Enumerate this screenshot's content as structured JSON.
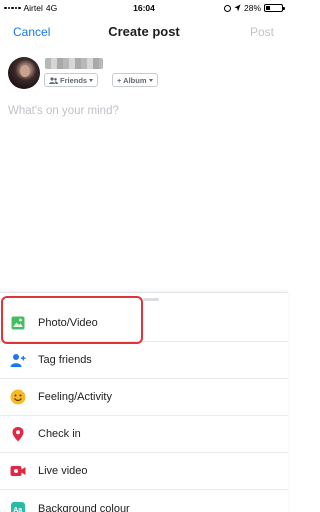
{
  "status_bar": {
    "carrier": "Airtel",
    "network": "4G",
    "time": "16:04",
    "battery_percent": "28%",
    "battery_level": 0.28
  },
  "nav": {
    "cancel_label": "Cancel",
    "title": "Create post",
    "post_label": "Post",
    "accent_color": "#1877f2"
  },
  "composer": {
    "audience_label": "Friends",
    "album_label": "+ Album",
    "placeholder": "What's on your mind?"
  },
  "options": [
    {
      "label": "Photo/Video",
      "icon": "photo-icon",
      "color": "#45bd62"
    },
    {
      "label": "Tag friends",
      "icon": "tag-friends-icon",
      "color": "#1877f2"
    },
    {
      "label": "Feeling/Activity",
      "icon": "feeling-icon",
      "color": "#f7b928"
    },
    {
      "label": "Check in",
      "icon": "location-pin-icon",
      "color": "#e42645"
    },
    {
      "label": "Live video",
      "icon": "live-video-icon",
      "color": "#e42645"
    },
    {
      "label": "Background colour",
      "icon": "background-colour-icon",
      "color": "#2abba7"
    }
  ],
  "highlight_color": "#e0343d"
}
